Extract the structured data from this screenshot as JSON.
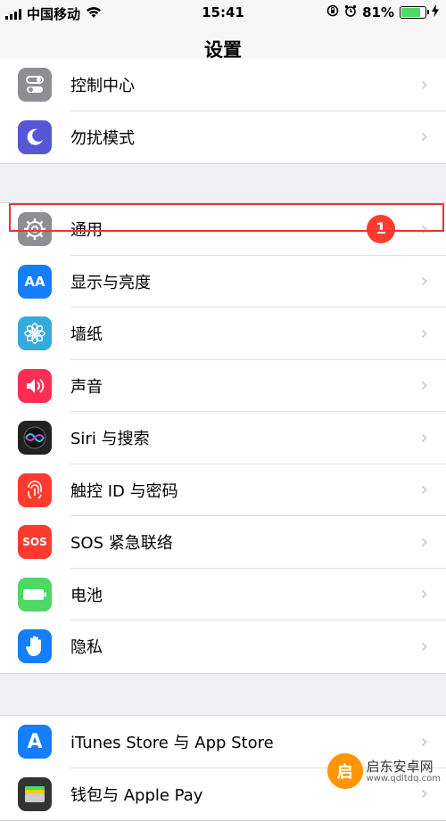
{
  "status_bar": {
    "carrier": "中国移动",
    "time": "15:41",
    "battery_percent": "81%",
    "battery_level": 0.81
  },
  "nav": {
    "title": "设置"
  },
  "group1": [
    {
      "label": "控制中心",
      "icon": "control-center-icon",
      "color": "#8e8e93"
    },
    {
      "label": "勿扰模式",
      "icon": "moon-icon",
      "color": "#5856d6"
    }
  ],
  "group2": [
    {
      "label": "通用",
      "icon": "gear-icon",
      "color": "#8e8e93",
      "badge": "1"
    },
    {
      "label": "显示与亮度",
      "icon": "display-icon",
      "color": "#147efb",
      "glyph": "AA"
    },
    {
      "label": "墙纸",
      "icon": "flower-icon",
      "color": "#35aadc"
    },
    {
      "label": "声音",
      "icon": "speaker-icon",
      "color": "#ff2d55"
    },
    {
      "label": "Siri 与搜索",
      "icon": "siri-icon",
      "color": "#222222"
    },
    {
      "label": "触控 ID 与密码",
      "icon": "fingerprint-icon",
      "color": "#ff3b30"
    },
    {
      "label": "SOS 紧急联络",
      "icon": "sos-icon",
      "color": "#ff3b30",
      "glyph": "SOS"
    },
    {
      "label": "电池",
      "icon": "battery-icon",
      "color": "#4cd964"
    },
    {
      "label": "隐私",
      "icon": "hand-icon",
      "color": "#147efb"
    }
  ],
  "group3": [
    {
      "label": "iTunes Store 与 App Store",
      "icon": "app-store-icon",
      "color": "#147efb",
      "glyph": "A"
    },
    {
      "label": "钱包与 Apple Pay",
      "icon": "wallet-icon",
      "color": "#333333"
    }
  ],
  "watermark": {
    "text": "启东安卓网",
    "sub": "www.qdltdq.com"
  }
}
